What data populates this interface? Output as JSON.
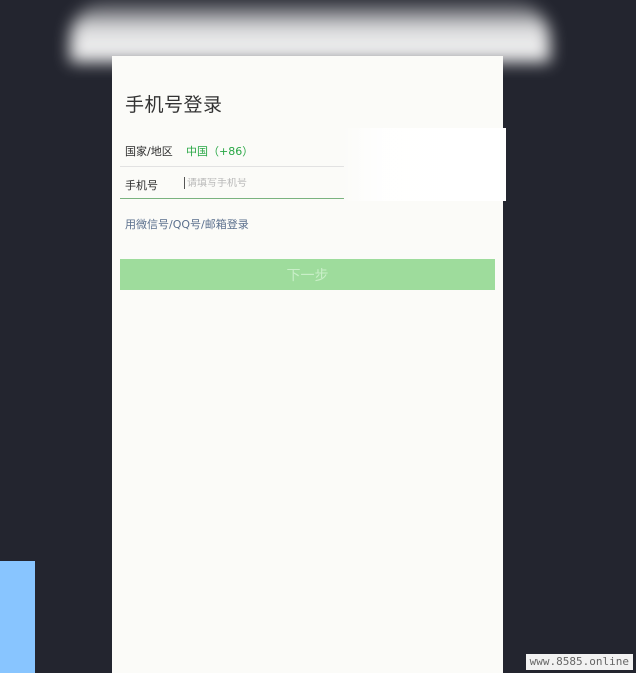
{
  "login": {
    "title": "手机号登录",
    "country_label": "国家/地区",
    "country_value": "中国（+86）",
    "phone_label": "手机号",
    "phone_placeholder": "请填写手机号",
    "phone_value": "",
    "alt_login_label": "用微信号/QQ号/邮箱登录",
    "next_button_label": "下一步"
  },
  "watermark": {
    "text": "www.8585.online"
  }
}
